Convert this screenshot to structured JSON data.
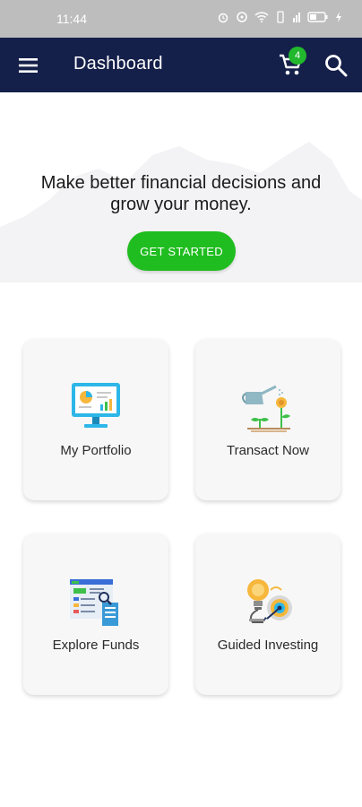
{
  "status_bar": {
    "time": "11:44"
  },
  "app_bar": {
    "title": "Dashboard",
    "cart_count": "4"
  },
  "hero": {
    "line1": "Make better financial decisions and",
    "line2": "grow your money.",
    "cta_label": "GET STARTED"
  },
  "cards": [
    {
      "label": "My Portfolio",
      "icon": "portfolio-monitor-icon"
    },
    {
      "label": "Transact Now",
      "icon": "watering-can-plant-icon"
    },
    {
      "label": "Explore Funds",
      "icon": "fund-document-icon"
    },
    {
      "label": "Guided Investing",
      "icon": "lightbulb-target-icon"
    }
  ],
  "colors": {
    "app_bar": "#15204a",
    "accent": "#1fbd1f",
    "badge": "#22b82e",
    "card": "#f7f7f7"
  }
}
